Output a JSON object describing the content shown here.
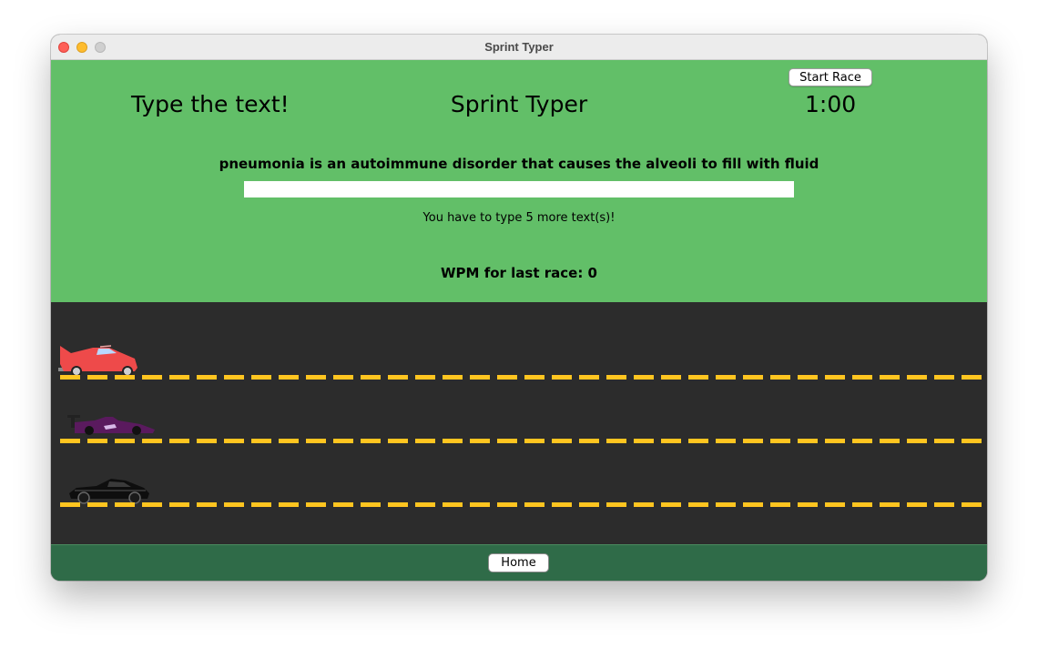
{
  "window": {
    "title": "Sprint Typer"
  },
  "header": {
    "instruction": "Type the text!",
    "app_title": "Sprint Typer",
    "timer": "1:00",
    "start_button_label": "Start Race"
  },
  "typing": {
    "prompt_text": "pneumonia is an autoimmune disorder that causes the alveoli to fill with fluid",
    "input_value": "",
    "remaining_message": "You have to type 5 more text(s)!"
  },
  "results": {
    "wpm_label": "WPM for last race: 0"
  },
  "track": {
    "line_color": "#ffc520",
    "cars": [
      {
        "name": "red-car",
        "color": "#ee4a4a"
      },
      {
        "name": "purple-race-car",
        "color": "#5a1a5e"
      },
      {
        "name": "black-sports-car",
        "color": "#0e0e0e"
      }
    ]
  },
  "footer": {
    "home_button_label": "Home"
  },
  "colors": {
    "top_panel": "#62bf68",
    "track": "#2c2c2c",
    "footer": "#2f6b48"
  }
}
